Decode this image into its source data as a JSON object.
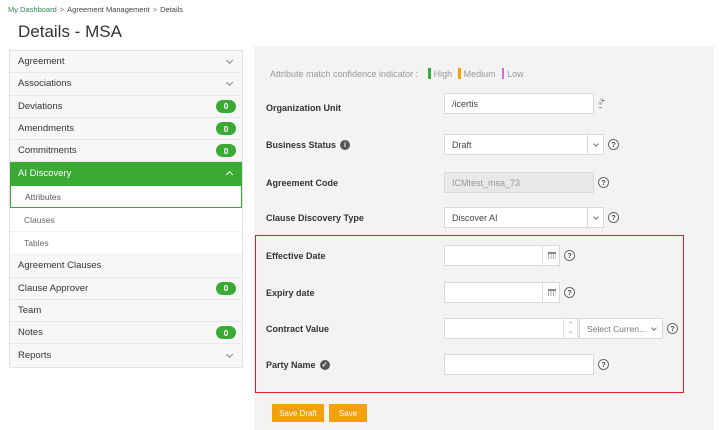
{
  "breadcrumb": {
    "items": [
      "My Dashboard",
      "Agreement Management",
      "Details"
    ],
    "separator": ">"
  },
  "page_title": "Details - MSA",
  "sidebar": {
    "items": [
      {
        "label": "Agreement",
        "chevron": "down"
      },
      {
        "label": "Associations",
        "chevron": "down"
      },
      {
        "label": "Deviations",
        "badge": "0"
      },
      {
        "label": "Amendments",
        "badge": "0"
      },
      {
        "label": "Commitments",
        "badge": "0"
      },
      {
        "label": "AI Discovery",
        "chevron": "up",
        "active": true
      },
      {
        "label": "Attributes",
        "sub": true,
        "selected": true
      },
      {
        "label": "Clauses",
        "sub": true
      },
      {
        "label": "Tables",
        "sub": true
      },
      {
        "label": "Agreement Clauses"
      },
      {
        "label": "Clause Approver",
        "badge": "0"
      },
      {
        "label": "Team"
      },
      {
        "label": "Notes",
        "badge": "0"
      },
      {
        "label": "Reports",
        "chevron": "down"
      }
    ]
  },
  "indicator": {
    "label": "Attribute match confidence indicator :",
    "levels": [
      {
        "label": "High",
        "color": "#3aaa35"
      },
      {
        "label": "Medium",
        "color": "#f2a10c"
      },
      {
        "label": "Low",
        "color": "#e066e0"
      }
    ]
  },
  "form": {
    "organization_unit": {
      "label": "Organization Unit",
      "value": "/icertis"
    },
    "business_status": {
      "label": "Business Status",
      "value": "Draft"
    },
    "agreement_code": {
      "label": "Agreement Code",
      "value": "ICMtest_msa_73"
    },
    "clause_discovery_type": {
      "label": "Clause Discovery Type",
      "value": "Discover AI"
    },
    "effective_date": {
      "label": "Effective Date",
      "value": ""
    },
    "expiry_date": {
      "label": "Expiry date",
      "value": ""
    },
    "contract_value": {
      "label": "Contract Value",
      "value": "",
      "currency_placeholder": "Select Curren..."
    },
    "party_name": {
      "label": "Party Name",
      "value": ""
    }
  },
  "buttons": {
    "save_draft": "Save Draft",
    "save": "Save"
  },
  "colors": {
    "accent_green": "#3aaa35",
    "button_orange": "#f2a10c",
    "highlight_red": "#e02020"
  }
}
